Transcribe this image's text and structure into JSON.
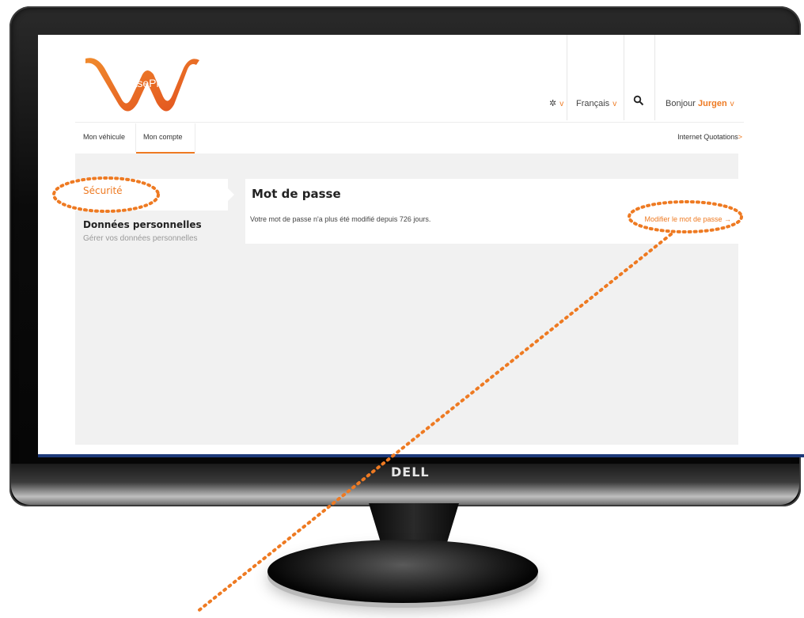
{
  "screen": {
    "logo": {
      "text": "LeasePlan"
    },
    "header": {
      "settings_icon": "gear-icon",
      "language": "Français",
      "search_icon": "search-icon",
      "greeting": "Bonjour",
      "username": "Jurgen"
    },
    "tabs": [
      {
        "label": "Mon véhicule",
        "active": false
      },
      {
        "label": "Mon compte",
        "active": true
      }
    ],
    "internet_quotations": {
      "label": "Internet Quotations",
      "arrow": ">"
    },
    "sidebar": {
      "items": [
        {
          "label": "Sécurité",
          "active": true
        },
        {
          "label": "Données personnelles",
          "sublabel": "Gérer vos données personnelles",
          "active": false
        }
      ]
    },
    "panel": {
      "title": "Mot de passe",
      "message": "Votre mot de passe n'a plus été modifié depuis 726 jours.",
      "action": "Modifier le mot de passe →"
    }
  },
  "monitor": {
    "brand": "DELL"
  },
  "colors": {
    "accent": "#ee7a22",
    "annotation": "#ee7a22",
    "content_bg": "#f1f1f1"
  }
}
